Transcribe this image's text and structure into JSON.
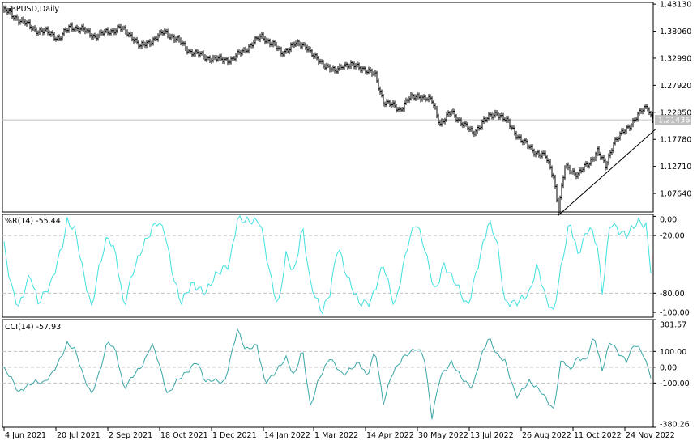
{
  "chart_data": [
    {
      "type": "ohlc",
      "title": "GBPUSD,Daily",
      "x_unit": "bar index (trading days from 4 Jun 2021)",
      "ylim": [
        1.0416,
        1.4345
      ],
      "yticks": [
        "1.43130",
        "1.38060",
        "1.32990",
        "1.27920",
        "1.22850",
        "1.17780",
        "1.12710",
        "1.07640"
      ],
      "current_price": "1.21436",
      "close_anchors": {
        "x": [
          2,
          10,
          20,
          30,
          35,
          42,
          50,
          57,
          65,
          72,
          80,
          85,
          92,
          100,
          107,
          115,
          125,
          135,
          142,
          150,
          160,
          167,
          172,
          180,
          187,
          192,
          200,
          205,
          210,
          215,
          222,
          230,
          235,
          245,
          250,
          257,
          265,
          270,
          277,
          285,
          290,
          297,
          305,
          312,
          320,
          327,
          335,
          340,
          343,
          347,
          355,
          362,
          367,
          372,
          377,
          385,
          392,
          398,
          401
        ],
        "close": [
          1.4186,
          1.4028,
          1.3838,
          1.3759,
          1.3664,
          1.3901,
          1.3822,
          1.3711,
          1.379,
          1.3869,
          1.3711,
          1.3505,
          1.3632,
          1.379,
          1.3664,
          1.3442,
          1.3315,
          1.3268,
          1.3283,
          1.3473,
          1.3711,
          1.3553,
          1.3394,
          1.3553,
          1.3553,
          1.3315,
          1.3157,
          1.303,
          1.3188,
          1.3157,
          1.3125,
          1.2967,
          1.2491,
          1.2333,
          1.2523,
          1.2602,
          1.2491,
          1.208,
          1.2285,
          1.2048,
          1.1889,
          1.2127,
          1.2285,
          1.208,
          1.1763,
          1.1573,
          1.1446,
          1.1097,
          1.0464,
          1.1256,
          1.1129,
          1.1335,
          1.1573,
          1.1256,
          1.1731,
          1.1969,
          1.2238,
          1.2396,
          1.2143
        ]
      },
      "trendline": {
        "x": [
          343,
          403
        ],
        "y": [
          1.0353,
          1.1969
        ]
      }
    },
    {
      "type": "line",
      "title": "%R(14) -55.44",
      "ylim": [
        -105,
        2
      ],
      "yticks": [
        "0.00",
        "-20.00",
        "-80.00",
        "-100.00"
      ],
      "levels": [
        -20,
        -80
      ],
      "color": "#40e0e0",
      "x": [
        1,
        5,
        10,
        17,
        22,
        30,
        37,
        40,
        45,
        50,
        55,
        60,
        65,
        70,
        75,
        80,
        87,
        95,
        100,
        105,
        110,
        117,
        125,
        132,
        140,
        145,
        152,
        159,
        165,
        170,
        175,
        180,
        185,
        190,
        197,
        202,
        207,
        212,
        220,
        227,
        235,
        242,
        250,
        255,
        260,
        267,
        272,
        280,
        287,
        295,
        300,
        305,
        310,
        317,
        325,
        330,
        335,
        340,
        345,
        350,
        355,
        362,
        367,
        370,
        375,
        380,
        385,
        392,
        397,
        400
      ],
      "y": [
        -30,
        -70,
        -95,
        -60,
        -90,
        -70,
        -30,
        -5,
        -15,
        -60,
        -95,
        -50,
        -20,
        -40,
        -95,
        -60,
        -30,
        -5,
        -15,
        -60,
        -90,
        -70,
        -80,
        -60,
        -50,
        -3,
        -5,
        -5,
        -60,
        -95,
        -40,
        -60,
        -10,
        -70,
        -100,
        -80,
        -30,
        -60,
        -90,
        -90,
        -50,
        -95,
        -30,
        -5,
        -30,
        -80,
        -50,
        -70,
        -95,
        -40,
        -5,
        -25,
        -90,
        -90,
        -80,
        -50,
        -85,
        -100,
        -50,
        -5,
        -40,
        -10,
        -30,
        -80,
        -5,
        -15,
        -20,
        -5,
        -10,
        -55.44
      ]
    },
    {
      "type": "line",
      "title": "CCI(14) -57.93",
      "ylim": [
        -380.26,
        301.57
      ],
      "yticks": [
        "301.57",
        "100.00",
        "0.00",
        "-100.00",
        "-380.26"
      ],
      "levels": [
        100,
        0,
        -100
      ],
      "color": "#3aa6a6",
      "x": [
        1,
        5,
        10,
        15,
        20,
        25,
        30,
        35,
        40,
        45,
        50,
        55,
        60,
        65,
        70,
        75,
        80,
        87,
        92,
        95,
        102,
        107,
        115,
        120,
        125,
        130,
        137,
        145,
        150,
        157,
        162,
        167,
        175,
        180,
        185,
        190,
        195,
        202,
        210,
        220,
        225,
        230,
        235,
        240,
        247,
        255,
        260,
        265,
        270,
        277,
        285,
        290,
        295,
        300,
        305,
        310,
        317,
        325,
        332,
        340,
        345,
        350,
        355,
        360,
        365,
        370,
        375,
        380,
        385,
        390,
        395,
        400
      ],
      "y": [
        -10,
        -60,
        -160,
        -120,
        -90,
        -100,
        -50,
        40,
        150,
        110,
        -60,
        -170,
        -30,
        170,
        100,
        -140,
        -60,
        20,
        150,
        80,
        -180,
        -90,
        -20,
        40,
        -90,
        -80,
        -100,
        240,
        110,
        140,
        -100,
        -50,
        60,
        -60,
        120,
        -250,
        -80,
        60,
        -50,
        30,
        -60,
        110,
        -230,
        -50,
        60,
        120,
        80,
        -320,
        -60,
        30,
        -90,
        -130,
        60,
        190,
        80,
        40,
        -190,
        -90,
        -150,
        -270,
        60,
        -20,
        60,
        40,
        200,
        -20,
        170,
        90,
        40,
        150,
        90,
        -57.93
      ]
    },
    {
      "type": "axis",
      "xticks": [
        {
          "x": 1,
          "label": "4 Jun 2021"
        },
        {
          "x": 33,
          "label": "20 Jul 2021"
        },
        {
          "x": 65,
          "label": "2 Sep 2021"
        },
        {
          "x": 97,
          "label": "18 Oct 2021"
        },
        {
          "x": 129,
          "label": "1 Dec 2021"
        },
        {
          "x": 161,
          "label": "14 Jan 2022"
        },
        {
          "x": 192,
          "label": "1 Mar 2022"
        },
        {
          "x": 224,
          "label": "14 Apr 2022"
        },
        {
          "x": 256,
          "label": "30 May 2022"
        },
        {
          "x": 288,
          "label": "13 Jul 2022"
        },
        {
          "x": 320,
          "label": "26 Aug 2022"
        },
        {
          "x": 352,
          "label": "11 Oct 2022"
        },
        {
          "x": 384,
          "label": "24 Nov 2022"
        }
      ]
    }
  ]
}
